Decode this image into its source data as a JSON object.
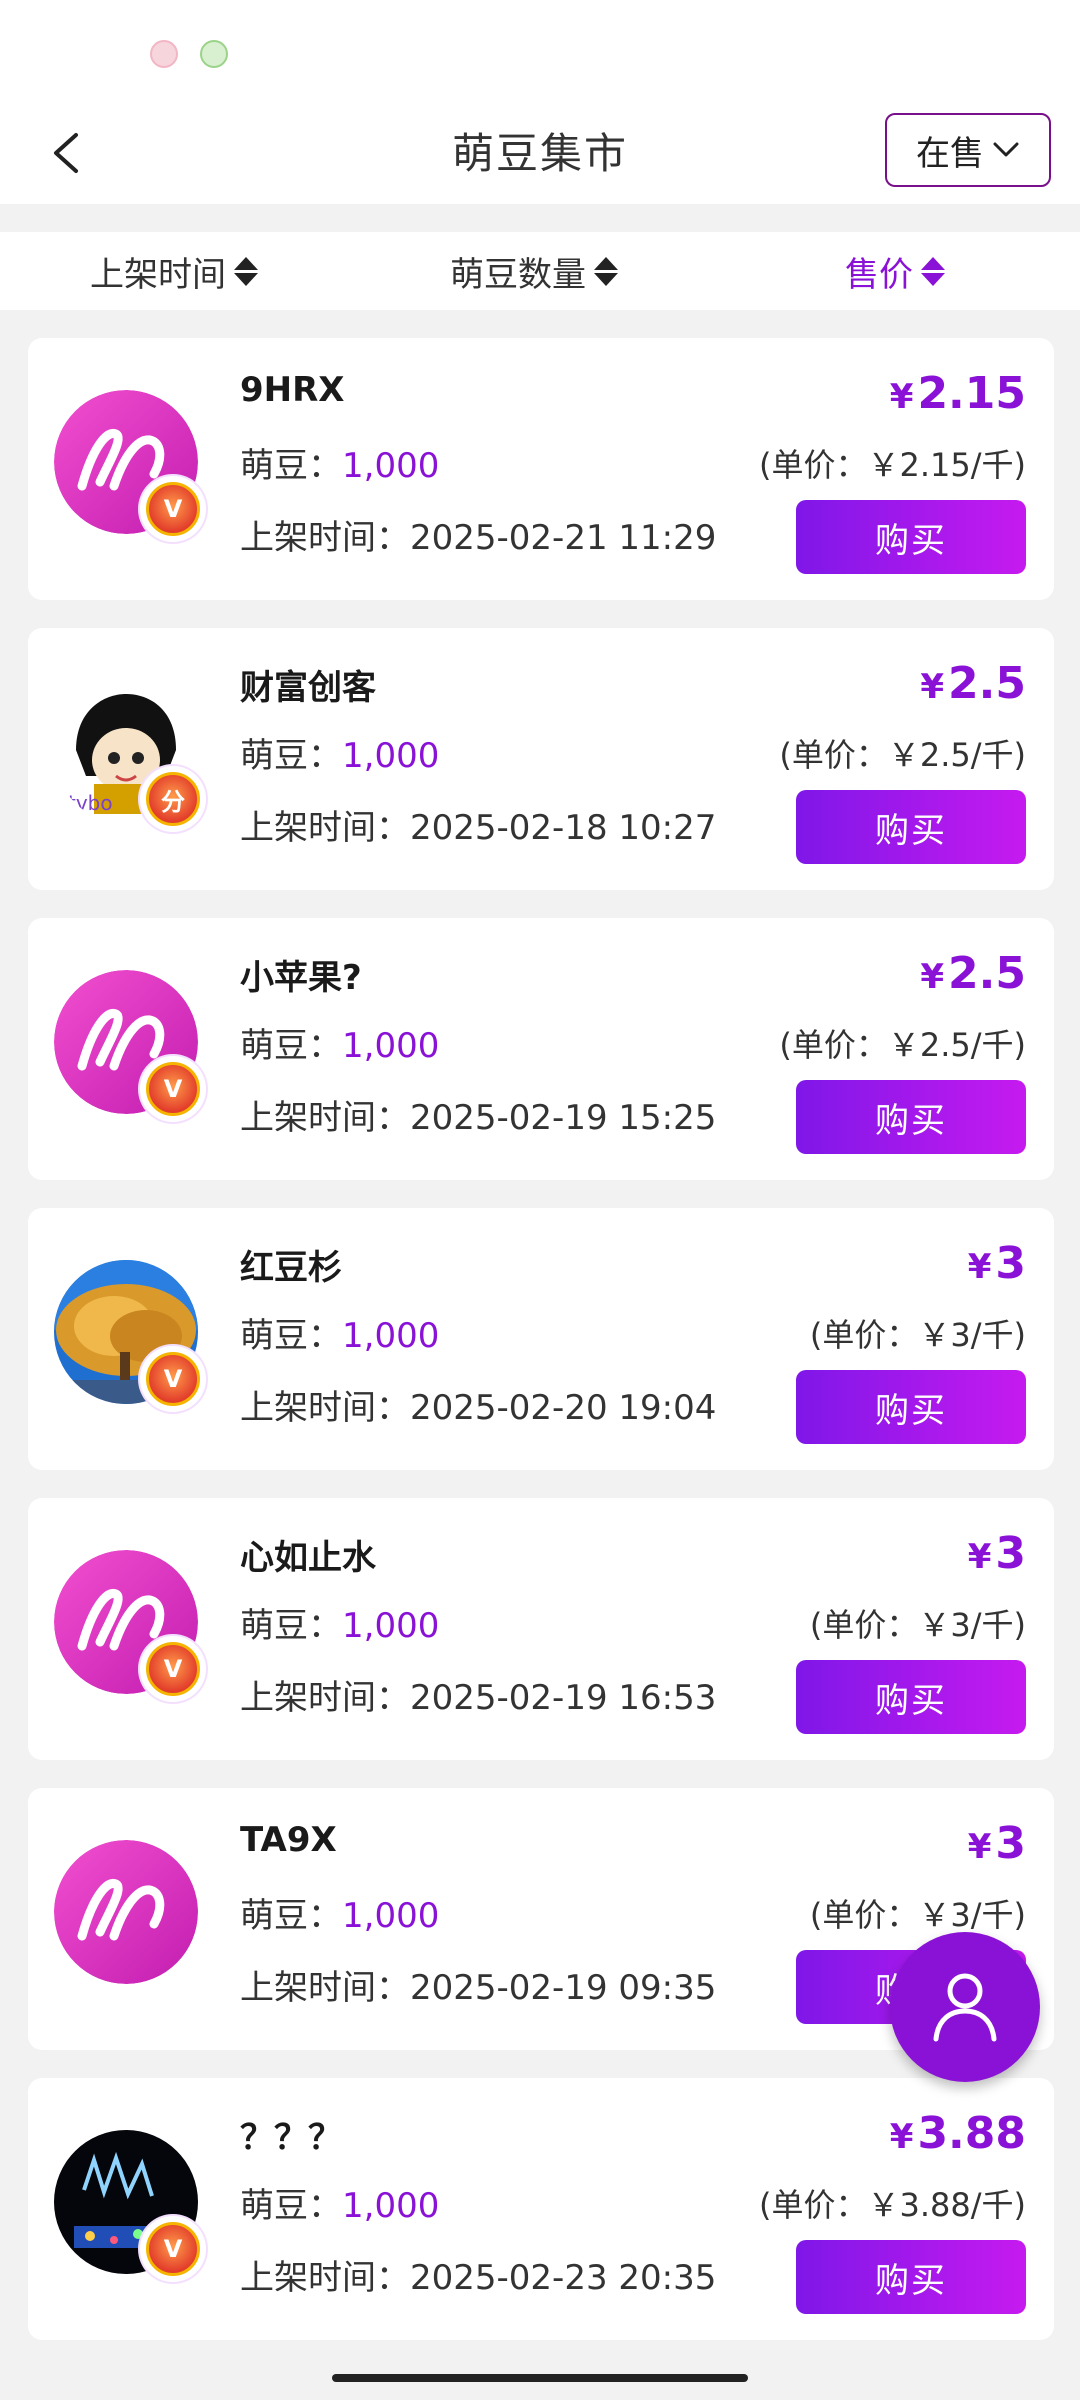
{
  "header": {
    "title": "萌豆集市",
    "status_filter": "在售"
  },
  "sort_bar": [
    {
      "label": "上架时间"
    },
    {
      "label": "萌豆数量"
    },
    {
      "label": "售价"
    }
  ],
  "colors": {
    "accent": "#8a12d6",
    "button_gradient_start": "#7f17e8",
    "button_gradient_end": "#c61aef"
  },
  "listings": [
    {
      "name": "9HRX",
      "beans_label": "萌豆：",
      "beans": "1,000",
      "listed_label": "上架时间：",
      "listed": "2025-02-21 11:29",
      "currency": "¥",
      "price": "2.15",
      "unit_price": "(单价：￥2.15/千)",
      "buy": "购买",
      "avatar": "mengou-logo-avatar",
      "badge": "V"
    },
    {
      "name": "财富创客",
      "beans_label": "萌豆：",
      "beans": "1,000",
      "listed_label": "上架时间：",
      "listed": "2025-02-18 10:27",
      "currency": "¥",
      "price": "2.5",
      "unit_price": "(单价：￥2.5/千)",
      "buy": "购买",
      "avatar": "cartoon-avatar",
      "badge": "分"
    },
    {
      "name": "小苹果?",
      "beans_label": "萌豆：",
      "beans": "1,000",
      "listed_label": "上架时间：",
      "listed": "2025-02-19 15:25",
      "currency": "¥",
      "price": "2.5",
      "unit_price": "(单价：￥2.5/千)",
      "buy": "购买",
      "avatar": "mengou-logo-avatar",
      "badge": "V"
    },
    {
      "name": "红豆杉",
      "beans_label": "萌豆：",
      "beans": "1,000",
      "listed_label": "上架时间：",
      "listed": "2025-02-20 19:04",
      "currency": "¥",
      "price": "3",
      "unit_price": "(单价：￥3/千)",
      "buy": "购买",
      "avatar": "tree-photo-avatar",
      "badge": "V"
    },
    {
      "name": "心如止水",
      "beans_label": "萌豆：",
      "beans": "1,000",
      "listed_label": "上架时间：",
      "listed": "2025-02-19 16:53",
      "currency": "¥",
      "price": "3",
      "unit_price": "(单价：￥3/千)",
      "buy": "购买",
      "avatar": "mengou-logo-avatar",
      "badge": "V"
    },
    {
      "name": "TA9X",
      "beans_label": "萌豆：",
      "beans": "1,000",
      "listed_label": "上架时间：",
      "listed": "2025-02-19 09:35",
      "currency": "¥",
      "price": "3",
      "unit_price": "(单价：￥3/千)",
      "buy": "购买",
      "avatar": "mengou-logo-avatar",
      "badge": ""
    },
    {
      "name": "？？？",
      "beans_label": "萌豆：",
      "beans": "1,000",
      "listed_label": "上架时间：",
      "listed": "2025-02-23 20:35",
      "currency": "¥",
      "price": "3.88",
      "unit_price": "(单价：￥3.88/千)",
      "buy": "购买",
      "avatar": "night-photo-avatar",
      "badge": "V"
    }
  ]
}
